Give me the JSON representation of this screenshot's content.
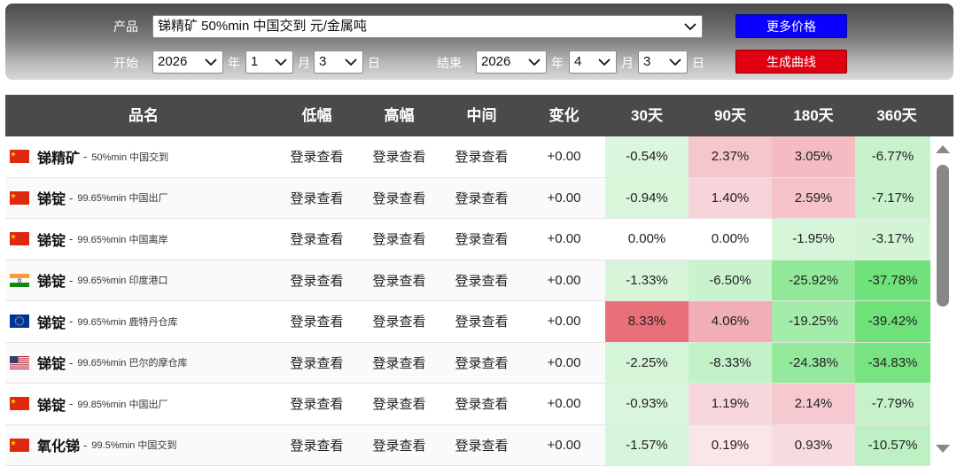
{
  "filters": {
    "product_label": "产品",
    "product_value": "锑精矿 50%min 中国交到 元/金属吨",
    "start_label": "开始",
    "start_year": "2026",
    "start_month": "1",
    "start_day": "3",
    "end_label": "结束",
    "end_year": "2026",
    "end_month": "4",
    "end_day": "3",
    "year_unit": "年",
    "month_unit": "月",
    "day_unit": "日",
    "more_prices_label": "更多价格",
    "generate_curve_label": "生成曲线"
  },
  "table": {
    "headers": [
      "品名",
      "低幅",
      "高幅",
      "中间",
      "变化",
      "30天",
      "90天",
      "180天",
      "360天"
    ],
    "rows": [
      {
        "flag": "cn",
        "name": "锑精矿",
        "desc": "50%min 中国交到",
        "low": "登录查看",
        "high": "登录查看",
        "mid": "登录查看",
        "change": "+0.00",
        "d30": "-0.54%",
        "d90": "2.37%",
        "d180": "3.05%",
        "d360": "-6.77%"
      },
      {
        "flag": "cn",
        "name": "锑锭",
        "desc": "99.65%min 中国出厂",
        "low": "登录查看",
        "high": "登录查看",
        "mid": "登录查看",
        "change": "+0.00",
        "d30": "-0.94%",
        "d90": "1.40%",
        "d180": "2.59%",
        "d360": "-7.17%"
      },
      {
        "flag": "cn",
        "name": "锑锭",
        "desc": "99.65%min 中国离岸",
        "low": "登录查看",
        "high": "登录查看",
        "mid": "登录查看",
        "change": "+0.00",
        "d30": "0.00%",
        "d90": "0.00%",
        "d180": "-1.95%",
        "d360": "-3.17%"
      },
      {
        "flag": "in",
        "name": "锑锭",
        "desc": "99.65%min 印度港口",
        "low": "登录查看",
        "high": "登录查看",
        "mid": "登录查看",
        "change": "+0.00",
        "d30": "-1.33%",
        "d90": "-6.50%",
        "d180": "-25.92%",
        "d360": "-37.78%"
      },
      {
        "flag": "eu",
        "name": "锑锭",
        "desc": "99.65%min 鹿特丹仓库",
        "low": "登录查看",
        "high": "登录查看",
        "mid": "登录查看",
        "change": "+0.00",
        "d30": "8.33%",
        "d90": "4.06%",
        "d180": "-19.25%",
        "d360": "-39.42%"
      },
      {
        "flag": "us",
        "name": "锑锭",
        "desc": "99.65%min 巴尔的摩仓库",
        "low": "登录查看",
        "high": "登录查看",
        "mid": "登录查看",
        "change": "+0.00",
        "d30": "-2.25%",
        "d90": "-8.33%",
        "d180": "-24.38%",
        "d360": "-34.83%"
      },
      {
        "flag": "cn",
        "name": "锑锭",
        "desc": "99.85%min 中国出厂",
        "low": "登录查看",
        "high": "登录查看",
        "mid": "登录查看",
        "change": "+0.00",
        "d30": "-0.93%",
        "d90": "1.19%",
        "d180": "2.14%",
        "d360": "-7.79%"
      },
      {
        "flag": "cn",
        "name": "氧化锑",
        "desc": "99.5%min 中国交到",
        "low": "登录查看",
        "high": "登录查看",
        "mid": "登录查看",
        "change": "+0.00",
        "d30": "-1.57%",
        "d90": "0.19%",
        "d180": "0.93%",
        "d360": "-10.57%"
      }
    ]
  },
  "colors": {
    "header_bg": "#4a4a4a",
    "btn_blue": "#0a00ff",
    "btn_red": "#e00010"
  }
}
